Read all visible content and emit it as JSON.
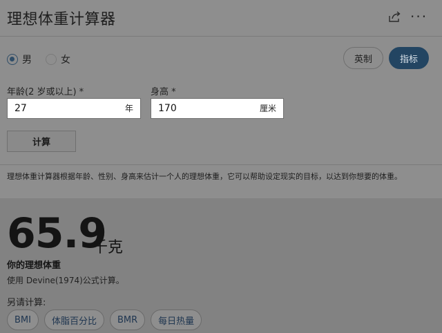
{
  "header": {
    "title": "理想体重计算器",
    "share_icon": "share-icon",
    "more_icon": "more-icon"
  },
  "gender": {
    "options": [
      {
        "label": "男",
        "selected": true
      },
      {
        "label": "女",
        "selected": false
      }
    ]
  },
  "units": {
    "imperial_label": "英制",
    "metric_label": "指标",
    "selected": "metric"
  },
  "age": {
    "label": "年龄(2 岁或以上) *",
    "value": "27",
    "unit": "年"
  },
  "height": {
    "label": "身高 *",
    "value": "170",
    "unit": "厘米"
  },
  "calculate_label": "计算",
  "description": "理想体重计算器根据年龄、性别、身高来估计一个人的理想体重，它可以帮助设定现实的目标，以达到你想要的体重。",
  "result": {
    "value": "65.9",
    "unit": "千克",
    "label": "你的理想体重",
    "note": "使用 Devine(1974)公式计算。"
  },
  "also": {
    "label": "另请计算:",
    "chips": [
      "BMI",
      "体脂百分比",
      "BMR",
      "每日热量"
    ]
  },
  "colors": {
    "accent": "#234562",
    "background": "#8e8e8e"
  }
}
